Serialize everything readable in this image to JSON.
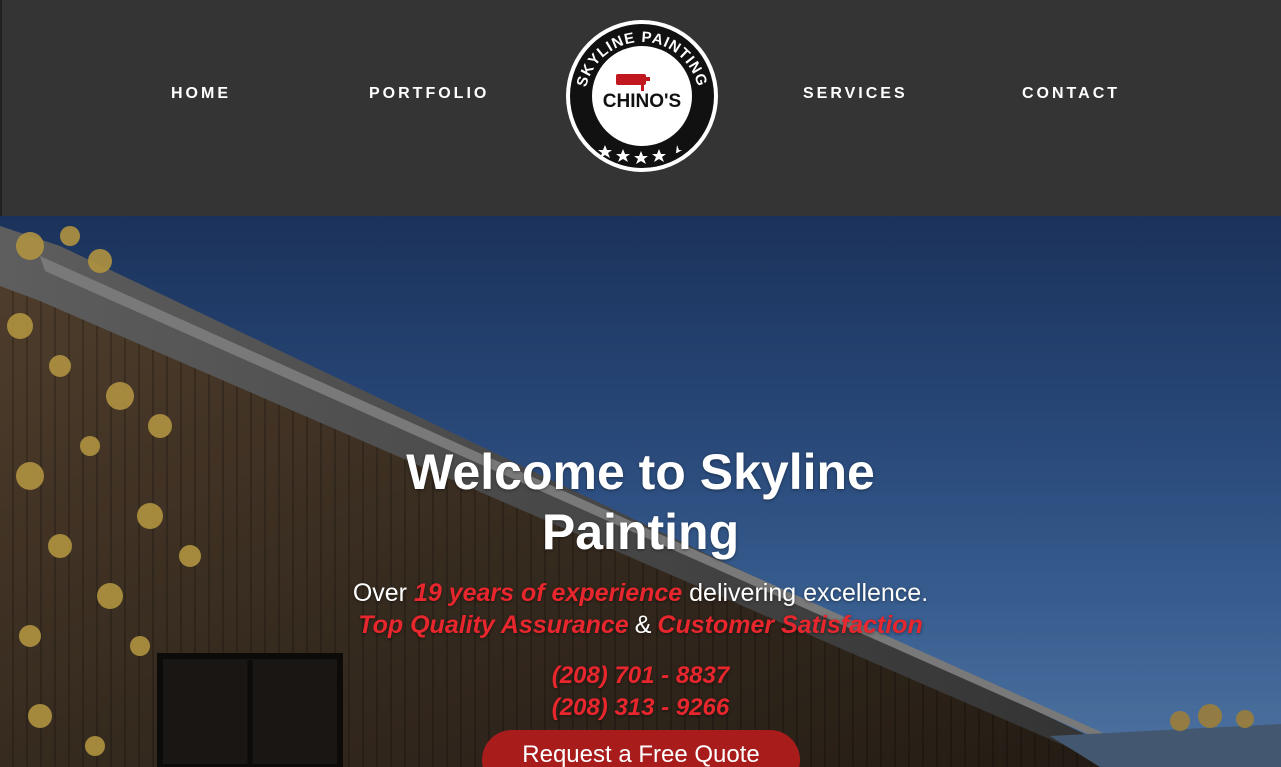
{
  "nav": {
    "home": "HOME",
    "portfolio": "PORTFOLIO",
    "services": "SERVICES",
    "contact": "CONTACT"
  },
  "logo": {
    "arc_text": "SKYLINE PAINTING",
    "name": "CHINO'S",
    "stars": 4.5
  },
  "hero": {
    "title": "Welcome to Skyline Painting",
    "line1_prefix": "Over ",
    "line1_highlight": "19 years of experience",
    "line1_suffix": " delivering excellence.",
    "line2_part1": "Top Quality Assurance",
    "line2_amp": "&",
    "line2_part2": "Customer Satisfaction",
    "phone1": "(208) 701 - 8837",
    "phone2": "(208) 313 - 9266",
    "cta_label": "Request a Free Quote"
  },
  "colors": {
    "header_bg": "#343434",
    "accent_red": "#e8262d",
    "button_red": "#a81c1c",
    "text_white": "#ffffff"
  }
}
